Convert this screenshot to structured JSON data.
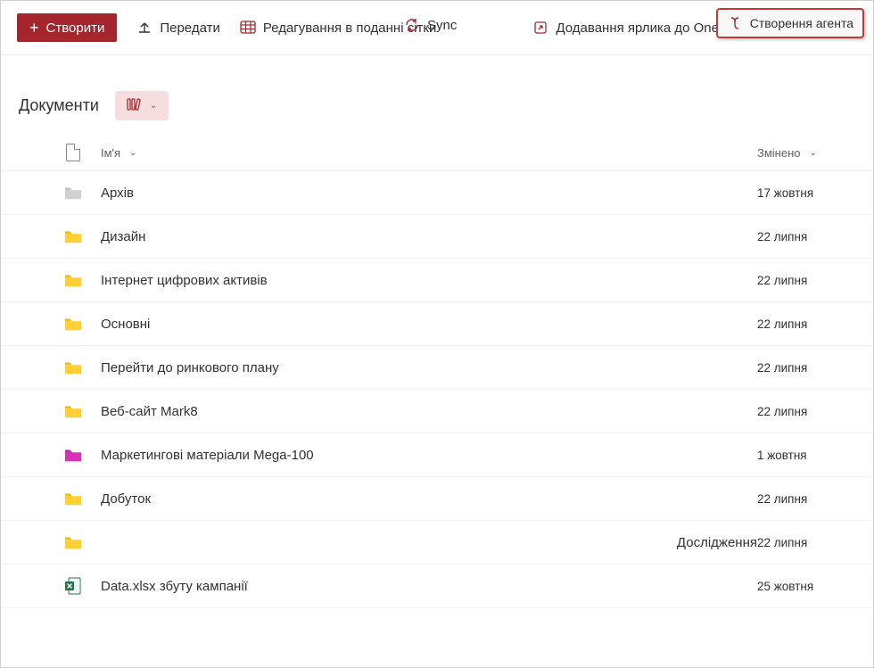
{
  "toolbar": {
    "create": "Створити",
    "upload": "Передати",
    "edit_grid": "Редагування в поданні сітки",
    "sync": "Sync",
    "add_shortcut": "Додавання ярлика до OneDrive",
    "create_agent": "Створення агента"
  },
  "header": {
    "title": "Документи"
  },
  "columns": {
    "name": "Ім'я",
    "modified": "Змінено"
  },
  "rows": [
    {
      "icon": "folder-gray",
      "name": "Архів",
      "modified": "17 жовтня",
      "align": "left"
    },
    {
      "icon": "folder-yellow",
      "name": "Дизайн",
      "modified": "22 липня",
      "align": "left"
    },
    {
      "icon": "folder-yellow",
      "name": "Інтернет цифрових активів",
      "modified": "22 липня",
      "align": "left"
    },
    {
      "icon": "folder-yellow",
      "name": "Основні",
      "modified": "22 липня",
      "align": "left"
    },
    {
      "icon": "folder-yellow",
      "name": "Перейти до ринкового плану",
      "modified": "22 липня",
      "align": "left"
    },
    {
      "icon": "folder-yellow",
      "name": "Веб-сайт Mark8",
      "modified": "22 липня",
      "align": "left"
    },
    {
      "icon": "folder-magenta",
      "name": "Маркетингові матеріали Mega-100",
      "modified": "1 жовтня",
      "align": "left"
    },
    {
      "icon": "folder-yellow",
      "name": "Добуток",
      "modified": "22 липня",
      "align": "left"
    },
    {
      "icon": "folder-yellow",
      "name": "Дослідження",
      "modified": "22 липня",
      "align": "right"
    },
    {
      "icon": "excel",
      "name": "Data.xlsx збуту кампанії",
      "modified": "25 жовтня",
      "align": "left"
    }
  ],
  "icon_colors": {
    "folder-gray": {
      "body": "#d0d0d0",
      "tab": "#bdbdbd"
    },
    "folder-yellow": {
      "body": "#ffcf33",
      "tab": "#e6b800"
    },
    "folder-magenta": {
      "body": "#d633b5",
      "tab": "#b32096"
    }
  }
}
